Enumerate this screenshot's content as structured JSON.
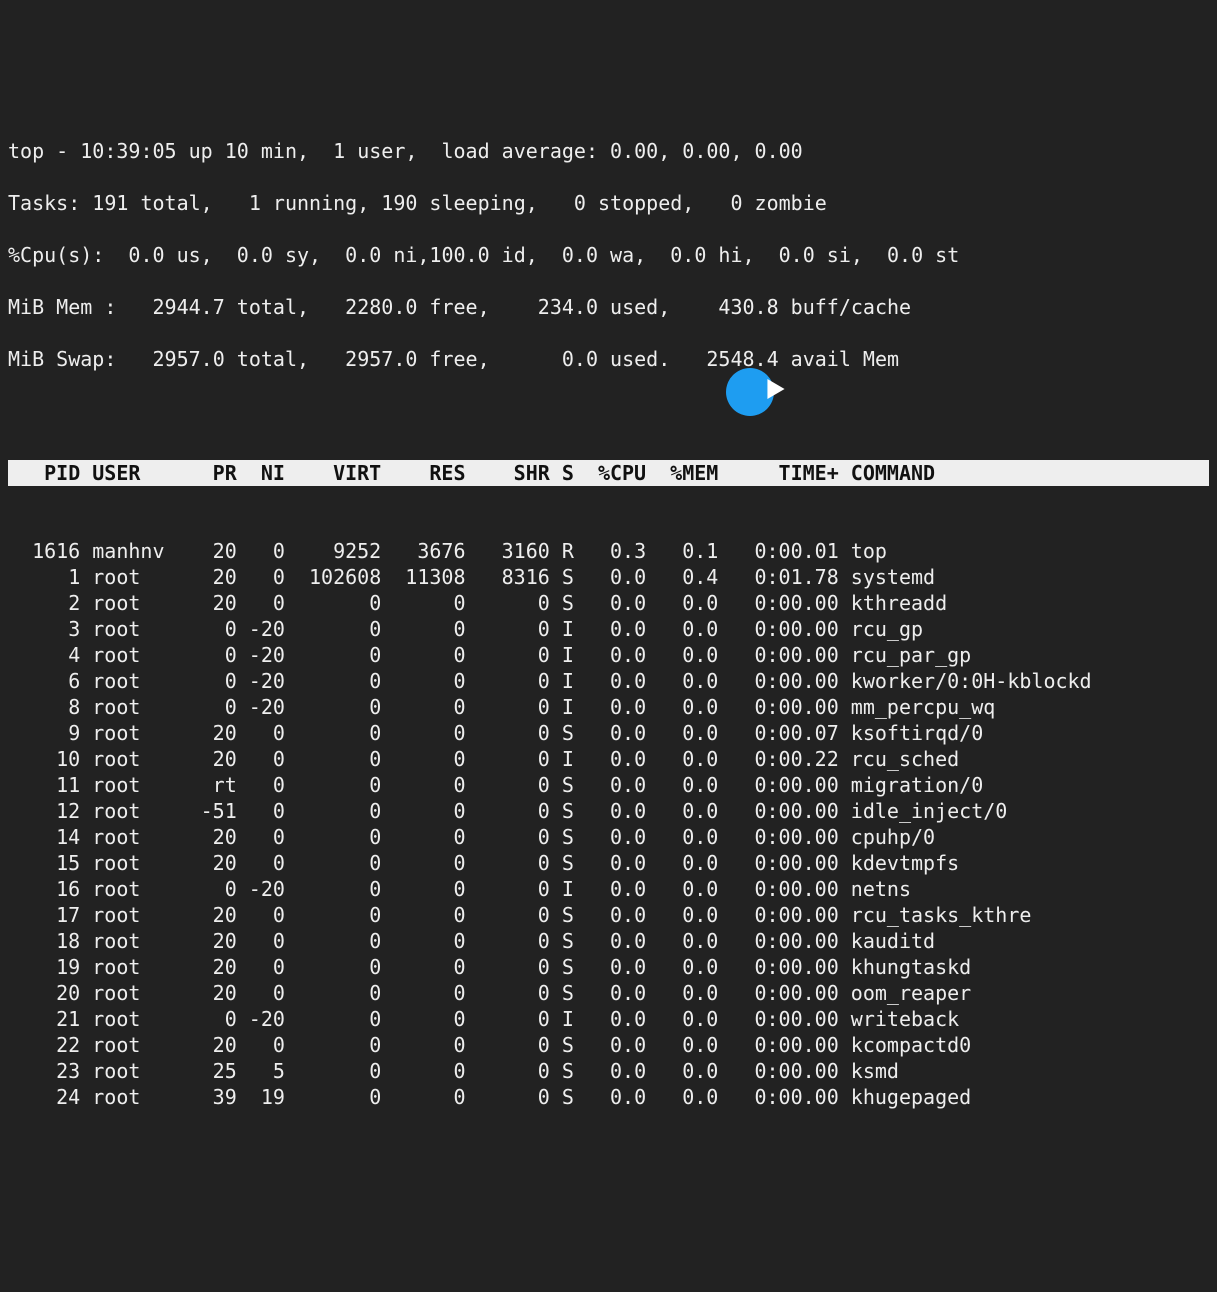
{
  "summary": {
    "line1": "top - 10:39:05 up 10 min,  1 user,  load average: 0.00, 0.00, 0.00",
    "line2": "Tasks: 191 total,   1 running, 190 sleeping,   0 stopped,   0 zombie",
    "line3": "%Cpu(s):  0.0 us,  0.0 sy,  0.0 ni,100.0 id,  0.0 wa,  0.0 hi,  0.0 si,  0.0 st",
    "line4": "MiB Mem :   2944.7 total,   2280.0 free,    234.0 used,    430.8 buff/cache",
    "line5": "MiB Swap:   2957.0 total,   2957.0 free,      0.0 used.   2548.4 avail Mem"
  },
  "columns": {
    "pid": "PID",
    "user": "USER",
    "pr": "PR",
    "ni": "NI",
    "virt": "VIRT",
    "res": "RES",
    "shr": "SHR",
    "s": "S",
    "cpu": "%CPU",
    "mem": "%MEM",
    "time": "TIME+",
    "cmd": "COMMAND"
  },
  "processes": [
    {
      "pid": "1616",
      "user": "manhnv",
      "pr": "20",
      "ni": "0",
      "virt": "9252",
      "res": "3676",
      "shr": "3160",
      "s": "R",
      "cpu": "0.3",
      "mem": "0.1",
      "time": "0:00.01",
      "cmd": "top"
    },
    {
      "pid": "1",
      "user": "root",
      "pr": "20",
      "ni": "0",
      "virt": "102608",
      "res": "11308",
      "shr": "8316",
      "s": "S",
      "cpu": "0.0",
      "mem": "0.4",
      "time": "0:01.78",
      "cmd": "systemd"
    },
    {
      "pid": "2",
      "user": "root",
      "pr": "20",
      "ni": "0",
      "virt": "0",
      "res": "0",
      "shr": "0",
      "s": "S",
      "cpu": "0.0",
      "mem": "0.0",
      "time": "0:00.00",
      "cmd": "kthreadd"
    },
    {
      "pid": "3",
      "user": "root",
      "pr": "0",
      "ni": "-20",
      "virt": "0",
      "res": "0",
      "shr": "0",
      "s": "I",
      "cpu": "0.0",
      "mem": "0.0",
      "time": "0:00.00",
      "cmd": "rcu_gp"
    },
    {
      "pid": "4",
      "user": "root",
      "pr": "0",
      "ni": "-20",
      "virt": "0",
      "res": "0",
      "shr": "0",
      "s": "I",
      "cpu": "0.0",
      "mem": "0.0",
      "time": "0:00.00",
      "cmd": "rcu_par_gp"
    },
    {
      "pid": "6",
      "user": "root",
      "pr": "0",
      "ni": "-20",
      "virt": "0",
      "res": "0",
      "shr": "0",
      "s": "I",
      "cpu": "0.0",
      "mem": "0.0",
      "time": "0:00.00",
      "cmd": "kworker/0:0H-kblockd"
    },
    {
      "pid": "8",
      "user": "root",
      "pr": "0",
      "ni": "-20",
      "virt": "0",
      "res": "0",
      "shr": "0",
      "s": "I",
      "cpu": "0.0",
      "mem": "0.0",
      "time": "0:00.00",
      "cmd": "mm_percpu_wq"
    },
    {
      "pid": "9",
      "user": "root",
      "pr": "20",
      "ni": "0",
      "virt": "0",
      "res": "0",
      "shr": "0",
      "s": "S",
      "cpu": "0.0",
      "mem": "0.0",
      "time": "0:00.07",
      "cmd": "ksoftirqd/0"
    },
    {
      "pid": "10",
      "user": "root",
      "pr": "20",
      "ni": "0",
      "virt": "0",
      "res": "0",
      "shr": "0",
      "s": "I",
      "cpu": "0.0",
      "mem": "0.0",
      "time": "0:00.22",
      "cmd": "rcu_sched"
    },
    {
      "pid": "11",
      "user": "root",
      "pr": "rt",
      "ni": "0",
      "virt": "0",
      "res": "0",
      "shr": "0",
      "s": "S",
      "cpu": "0.0",
      "mem": "0.0",
      "time": "0:00.00",
      "cmd": "migration/0"
    },
    {
      "pid": "12",
      "user": "root",
      "pr": "-51",
      "ni": "0",
      "virt": "0",
      "res": "0",
      "shr": "0",
      "s": "S",
      "cpu": "0.0",
      "mem": "0.0",
      "time": "0:00.00",
      "cmd": "idle_inject/0"
    },
    {
      "pid": "14",
      "user": "root",
      "pr": "20",
      "ni": "0",
      "virt": "0",
      "res": "0",
      "shr": "0",
      "s": "S",
      "cpu": "0.0",
      "mem": "0.0",
      "time": "0:00.00",
      "cmd": "cpuhp/0"
    },
    {
      "pid": "15",
      "user": "root",
      "pr": "20",
      "ni": "0",
      "virt": "0",
      "res": "0",
      "shr": "0",
      "s": "S",
      "cpu": "0.0",
      "mem": "0.0",
      "time": "0:00.00",
      "cmd": "kdevtmpfs"
    },
    {
      "pid": "16",
      "user": "root",
      "pr": "0",
      "ni": "-20",
      "virt": "0",
      "res": "0",
      "shr": "0",
      "s": "I",
      "cpu": "0.0",
      "mem": "0.0",
      "time": "0:00.00",
      "cmd": "netns"
    },
    {
      "pid": "17",
      "user": "root",
      "pr": "20",
      "ni": "0",
      "virt": "0",
      "res": "0",
      "shr": "0",
      "s": "S",
      "cpu": "0.0",
      "mem": "0.0",
      "time": "0:00.00",
      "cmd": "rcu_tasks_kthre"
    },
    {
      "pid": "18",
      "user": "root",
      "pr": "20",
      "ni": "0",
      "virt": "0",
      "res": "0",
      "shr": "0",
      "s": "S",
      "cpu": "0.0",
      "mem": "0.0",
      "time": "0:00.00",
      "cmd": "kauditd"
    },
    {
      "pid": "19",
      "user": "root",
      "pr": "20",
      "ni": "0",
      "virt": "0",
      "res": "0",
      "shr": "0",
      "s": "S",
      "cpu": "0.0",
      "mem": "0.0",
      "time": "0:00.00",
      "cmd": "khungtaskd"
    },
    {
      "pid": "20",
      "user": "root",
      "pr": "20",
      "ni": "0",
      "virt": "0",
      "res": "0",
      "shr": "0",
      "s": "S",
      "cpu": "0.0",
      "mem": "0.0",
      "time": "0:00.00",
      "cmd": "oom_reaper"
    },
    {
      "pid": "21",
      "user": "root",
      "pr": "0",
      "ni": "-20",
      "virt": "0",
      "res": "0",
      "shr": "0",
      "s": "I",
      "cpu": "0.0",
      "mem": "0.0",
      "time": "0:00.00",
      "cmd": "writeback"
    },
    {
      "pid": "22",
      "user": "root",
      "pr": "20",
      "ni": "0",
      "virt": "0",
      "res": "0",
      "shr": "0",
      "s": "S",
      "cpu": "0.0",
      "mem": "0.0",
      "time": "0:00.00",
      "cmd": "kcompactd0"
    },
    {
      "pid": "23",
      "user": "root",
      "pr": "25",
      "ni": "5",
      "virt": "0",
      "res": "0",
      "shr": "0",
      "s": "S",
      "cpu": "0.0",
      "mem": "0.0",
      "time": "0:00.00",
      "cmd": "ksmd"
    },
    {
      "pid": "24",
      "user": "root",
      "pr": "39",
      "ni": "19",
      "virt": "0",
      "res": "0",
      "shr": "0",
      "s": "S",
      "cpu": "0.0",
      "mem": "0.0",
      "time": "0:00.00",
      "cmd": "khugepaged"
    }
  ],
  "overlay": {
    "play_icon": "play"
  }
}
